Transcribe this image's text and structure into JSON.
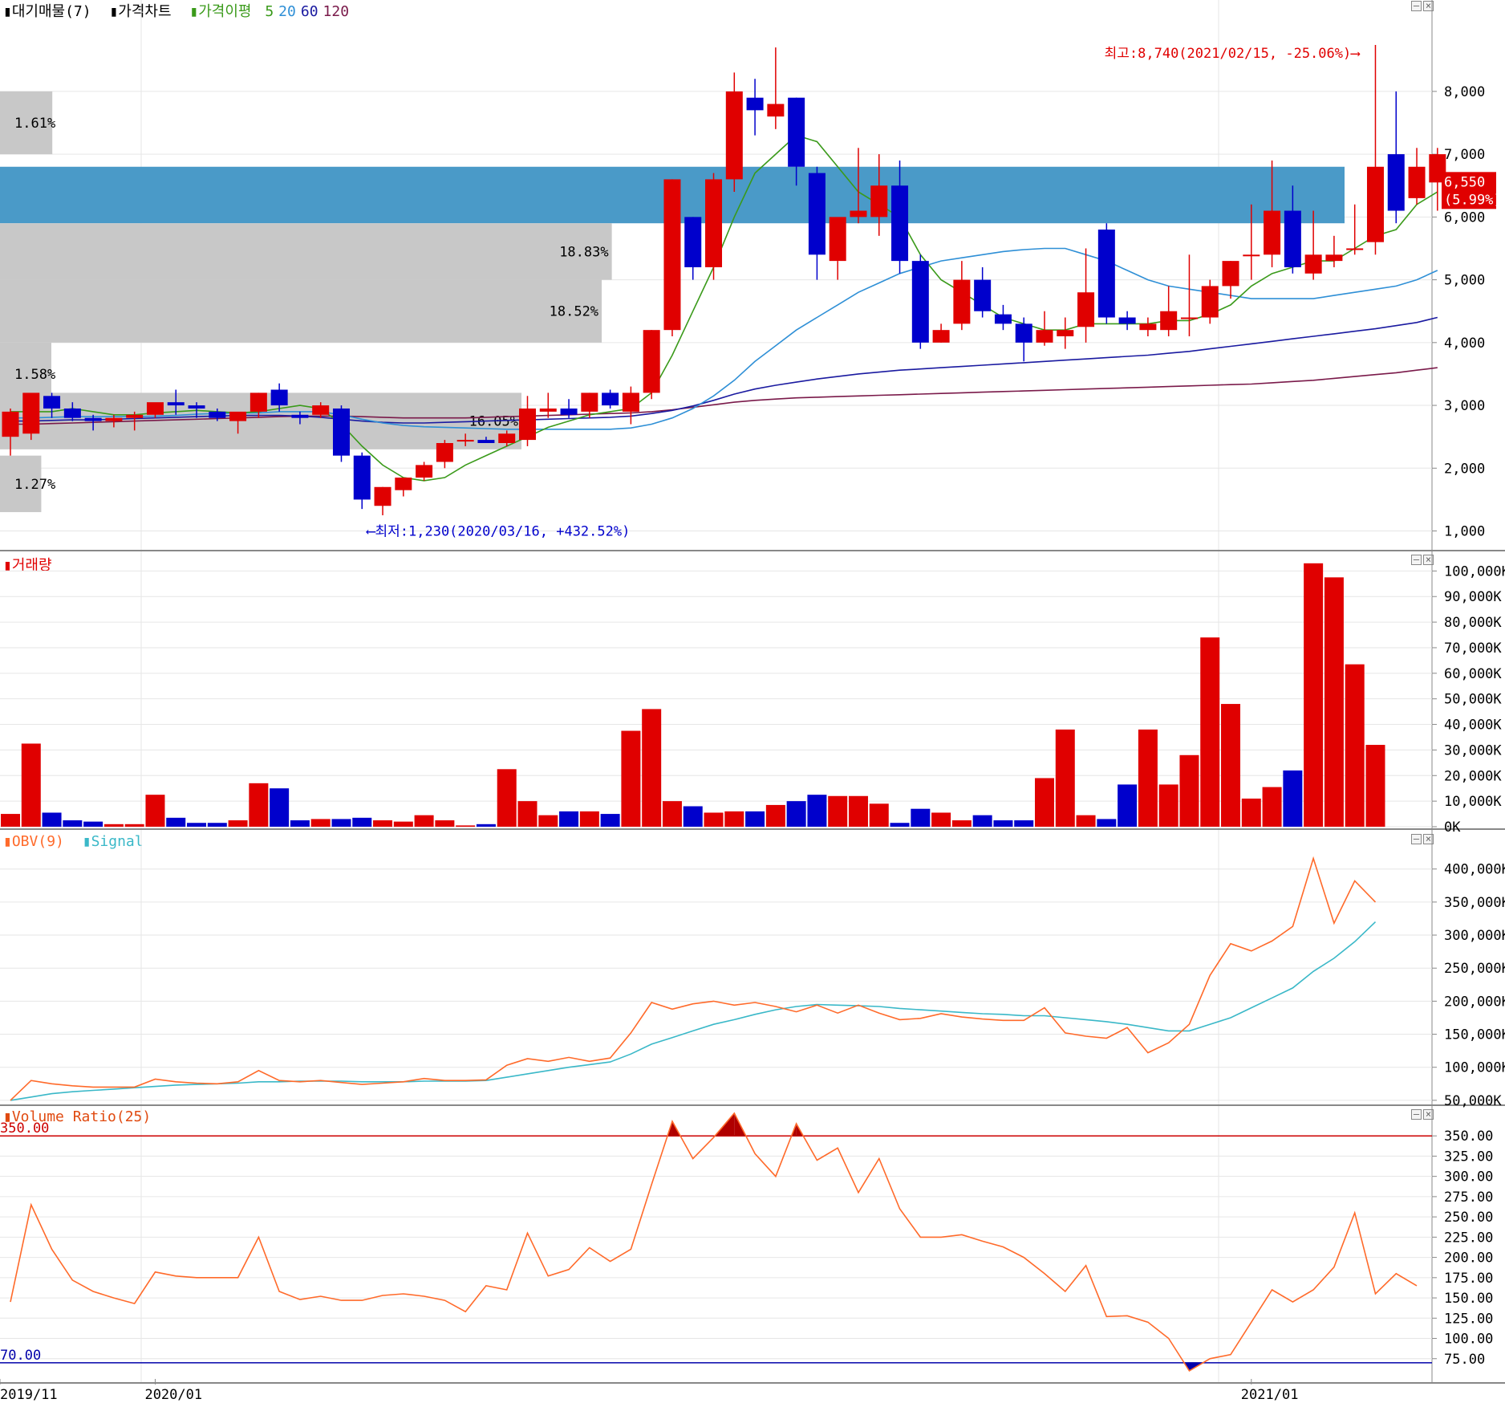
{
  "legend": {
    "price": {
      "volume_profile": "대기매물(7)",
      "price_chart": "가격차트",
      "ma_label": "가격이평",
      "ma5": "5",
      "ma20": "20",
      "ma60": "60",
      "ma120": "120"
    },
    "volume": "거래량",
    "obv": "OBV(9)",
    "signal": "Signal",
    "volume_ratio": "Volume Ratio(25)"
  },
  "colors": {
    "up": "#e00000",
    "down": "#0000cc",
    "ma5": "#3a9a1a",
    "ma20": "#2e8fd6",
    "ma60": "#1a1aa0",
    "ma120": "#7a1a4a",
    "obv": "#ff6a2a",
    "signal": "#3ab8c8",
    "vr": "#ff6a2a",
    "profile": "#c8c8c8",
    "profile_highlight": "#4a9ac8"
  },
  "chart_data": [
    {
      "type": "candlestick",
      "ylim": [
        700,
        9200
      ],
      "yticks": [
        "1,000",
        "2,000",
        "3,000",
        "4,000",
        "5,000",
        "6,000",
        "7,000",
        "8,000"
      ],
      "ytick_values": [
        1000,
        2000,
        3000,
        4000,
        5000,
        6000,
        7000,
        8000
      ],
      "x_labels": [
        {
          "index": 0,
          "label": "2019/11"
        },
        {
          "index": 7,
          "label": "2020/01"
        },
        {
          "index": 60,
          "label": "2021/01"
        }
      ],
      "candles": [
        [
          2500,
          2950,
          2200,
          2900
        ],
        [
          2550,
          3100,
          2450,
          3200
        ],
        [
          3150,
          3200,
          2800,
          2950
        ],
        [
          2950,
          3050,
          2750,
          2800
        ],
        [
          2800,
          2850,
          2600,
          2750
        ],
        [
          2750,
          2850,
          2650,
          2800
        ],
        [
          2800,
          2900,
          2600,
          2850
        ],
        [
          2850,
          2950,
          2800,
          3050
        ],
        [
          3050,
          3250,
          2850,
          3000
        ],
        [
          3000,
          3050,
          2800,
          2950
        ],
        [
          2900,
          2950,
          2750,
          2800
        ],
        [
          2750,
          2850,
          2550,
          2900
        ],
        [
          2900,
          3200,
          2800,
          3200
        ],
        [
          3250,
          3350,
          2900,
          3000
        ],
        [
          2850,
          2900,
          2700,
          2800
        ],
        [
          2850,
          3050,
          2800,
          3000
        ],
        [
          2950,
          3000,
          2100,
          2200
        ],
        [
          2200,
          2250,
          1350,
          1500
        ],
        [
          1400,
          1700,
          1250,
          1700
        ],
        [
          1650,
          1850,
          1550,
          1850
        ],
        [
          1850,
          2100,
          1800,
          2050
        ],
        [
          2100,
          2450,
          2000,
          2400
        ],
        [
          2450,
          2550,
          2350,
          2450
        ],
        [
          2450,
          2500,
          2400,
          2400
        ],
        [
          2400,
          2600,
          2350,
          2550
        ],
        [
          2450,
          3150,
          2350,
          2950
        ],
        [
          2900,
          3200,
          2800,
          2950
        ],
        [
          2950,
          3100,
          2800,
          2850
        ],
        [
          2900,
          3200,
          2800,
          3200
        ],
        [
          3200,
          3250,
          2950,
          3000
        ],
        [
          2900,
          3300,
          2700,
          3200
        ],
        [
          3200,
          4200,
          3100,
          4200
        ],
        [
          4200,
          6600,
          4100,
          6600
        ],
        [
          6000,
          6000,
          5000,
          5200
        ],
        [
          5200,
          6700,
          5000,
          6600
        ],
        [
          6600,
          8300,
          6400,
          8000
        ],
        [
          7900,
          8200,
          7300,
          7700
        ],
        [
          7600,
          8700,
          7400,
          7800
        ],
        [
          7900,
          7900,
          6500,
          6800
        ],
        [
          6700,
          6800,
          5000,
          5400
        ],
        [
          5300,
          5300,
          5000,
          6000
        ],
        [
          6000,
          7100,
          5900,
          6100
        ],
        [
          6000,
          7000,
          5700,
          6500
        ],
        [
          6500,
          6900,
          5100,
          5300
        ],
        [
          5300,
          5400,
          3900,
          4000
        ],
        [
          4000,
          4300,
          4000,
          4200
        ],
        [
          4300,
          5300,
          4200,
          5000
        ],
        [
          5000,
          5200,
          4400,
          4500
        ],
        [
          4450,
          4600,
          4200,
          4300
        ],
        [
          4300,
          4400,
          3700,
          4000
        ],
        [
          4000,
          4500,
          3950,
          4200
        ],
        [
          4100,
          4400,
          3900,
          4200
        ],
        [
          4250,
          5500,
          4000,
          4800
        ],
        [
          5800,
          5900,
          4300,
          4400
        ],
        [
          4400,
          4500,
          4200,
          4300
        ],
        [
          4200,
          4400,
          4100,
          4300
        ],
        [
          4200,
          4900,
          4100,
          4500
        ],
        [
          4400,
          5400,
          4100,
          4400
        ],
        [
          4400,
          5000,
          4300,
          4900
        ],
        [
          4900,
          5300,
          4700,
          5300
        ],
        [
          5400,
          6200,
          5000,
          5400
        ],
        [
          5400,
          6900,
          5200,
          6100
        ],
        [
          6100,
          6500,
          5100,
          5200
        ],
        [
          5100,
          6100,
          5000,
          5400
        ],
        [
          5300,
          5700,
          5200,
          5400
        ],
        [
          5500,
          6200,
          5400,
          5500
        ],
        [
          5600,
          8740,
          5400,
          6800
        ],
        [
          7000,
          8000,
          5900,
          6100
        ],
        [
          6300,
          7100,
          6200,
          6800
        ],
        [
          6550,
          7100,
          6100,
          7000
        ]
      ],
      "ma5": [
        2900,
        2900,
        2900,
        2950,
        2900,
        2850,
        2850,
        2880,
        2900,
        2920,
        2900,
        2880,
        2900,
        2950,
        3000,
        2950,
        2700,
        2350,
        2050,
        1850,
        1800,
        1850,
        2050,
        2200,
        2350,
        2500,
        2650,
        2750,
        2850,
        2900,
        2950,
        3200,
        3800,
        4500,
        5200,
        6000,
        6700,
        7000,
        7300,
        7200,
        6800,
        6400,
        6200,
        6000,
        5400,
        5000,
        4800,
        4600,
        4400,
        4300,
        4200,
        4200,
        4300,
        4300,
        4300,
        4300,
        4350,
        4350,
        4450,
        4600,
        4900,
        5100,
        5200,
        5300,
        5300,
        5500,
        5700,
        5800,
        6200,
        6400
      ],
      "ma20": [
        2800,
        2800,
        2810,
        2820,
        2820,
        2820,
        2820,
        2830,
        2840,
        2860,
        2870,
        2880,
        2880,
        2900,
        2900,
        2900,
        2850,
        2780,
        2720,
        2680,
        2660,
        2650,
        2640,
        2630,
        2620,
        2620,
        2620,
        2620,
        2620,
        2620,
        2640,
        2700,
        2800,
        2950,
        3150,
        3400,
        3700,
        3950,
        4200,
        4400,
        4600,
        4800,
        4950,
        5100,
        5200,
        5300,
        5350,
        5400,
        5450,
        5480,
        5500,
        5500,
        5400,
        5300,
        5150,
        5000,
        4900,
        4850,
        4800,
        4750,
        4700,
        4700,
        4700,
        4700,
        4750,
        4800,
        4850,
        4900,
        5000,
        5150
      ],
      "ma60": [
        2750,
        2750,
        2760,
        2770,
        2770,
        2780,
        2790,
        2800,
        2810,
        2820,
        2830,
        2840,
        2840,
        2840,
        2830,
        2810,
        2780,
        2750,
        2730,
        2720,
        2720,
        2730,
        2740,
        2750,
        2760,
        2770,
        2780,
        2790,
        2800,
        2810,
        2830,
        2870,
        2920,
        2990,
        3080,
        3180,
        3260,
        3320,
        3370,
        3420,
        3460,
        3500,
        3530,
        3560,
        3580,
        3600,
        3620,
        3640,
        3660,
        3680,
        3700,
        3720,
        3740,
        3760,
        3780,
        3800,
        3830,
        3860,
        3900,
        3940,
        3980,
        4020,
        4060,
        4100,
        4140,
        4180,
        4220,
        4270,
        4320,
        4400
      ],
      "ma120": [
        2700,
        2700,
        2710,
        2720,
        2730,
        2740,
        2750,
        2760,
        2770,
        2780,
        2790,
        2800,
        2810,
        2820,
        2830,
        2830,
        2830,
        2820,
        2810,
        2800,
        2800,
        2800,
        2800,
        2810,
        2820,
        2830,
        2840,
        2850,
        2860,
        2870,
        2880,
        2900,
        2930,
        2970,
        3010,
        3050,
        3080,
        3100,
        3120,
        3130,
        3140,
        3150,
        3160,
        3170,
        3180,
        3190,
        3200,
        3210,
        3220,
        3230,
        3240,
        3250,
        3260,
        3270,
        3280,
        3290,
        3300,
        3310,
        3320,
        3330,
        3340,
        3360,
        3380,
        3400,
        3430,
        3460,
        3490,
        3520,
        3560,
        3600
      ],
      "volume_profile": [
        {
          "low": 7000,
          "high": 8000,
          "pct": 1.61,
          "label": "1.61%"
        },
        {
          "low": 5900,
          "high": 6800,
          "pct": 100,
          "label": "",
          "highlight": true
        },
        {
          "low": 5000,
          "high": 5900,
          "pct": 18.83,
          "label": "18.83%"
        },
        {
          "low": 4000,
          "high": 5000,
          "pct": 18.52,
          "label": "18.52%"
        },
        {
          "low": 3000,
          "high": 4000,
          "pct": 1.58,
          "label": "1.58%"
        },
        {
          "low": 2300,
          "high": 3200,
          "pct": 16.05,
          "label": "16.05%"
        },
        {
          "low": 1300,
          "high": 2200,
          "pct": 1.27,
          "label": "1.27%"
        }
      ],
      "annotations": {
        "high": "최고:8,740(2021/02/15, -25.06%)",
        "low": "최저:1,230(2020/03/16, +432.52%)"
      },
      "current_price": {
        "value": 6550,
        "label": "6,550",
        "change": "(5.99%)"
      }
    },
    {
      "type": "bar",
      "title": "거래량",
      "ylim": [
        0,
        102000
      ],
      "yticks": [
        "0K",
        "10,000K",
        "20,000K",
        "30,000K",
        "40,000K",
        "50,000K",
        "60,000K",
        "70,000K",
        "80,000K",
        "90,000K",
        "100,000K"
      ],
      "ytick_values": [
        0,
        10000,
        20000,
        30000,
        40000,
        50000,
        60000,
        70000,
        80000,
        90000,
        100000
      ],
      "units": "K",
      "values": [
        5000,
        32500,
        5500,
        2500,
        2000,
        1000,
        1000,
        12500,
        3500,
        1500,
        1500,
        2500,
        17000,
        15000,
        2500,
        3000,
        3000,
        3500,
        2500,
        2000,
        4500,
        2500,
        500,
        1000,
        22500,
        10000,
        4500,
        6000,
        6000,
        5000,
        37500,
        46000,
        10000,
        8000,
        5500,
        6000,
        6000,
        8500,
        10000,
        12500,
        12000,
        12000,
        9000,
        1500,
        7000,
        5500,
        2500,
        4500,
        2500,
        2500,
        19000,
        38000,
        4500,
        3000,
        16500,
        38000,
        16500,
        28000,
        74000,
        48000,
        11000,
        15500,
        22000,
        103000,
        97500,
        63500,
        32000
      ]
    },
    {
      "type": "line",
      "title": "OBV(9)",
      "ylim": [
        45000,
        430000
      ],
      "yticks": [
        "50,000K",
        "100,000K",
        "150,000K",
        "200,000K",
        "250,000K",
        "300,000K",
        "350,000K",
        "400,000K"
      ],
      "ytick_values": [
        50000,
        100000,
        150000,
        200000,
        250000,
        300000,
        350000,
        400000
      ],
      "units": "K",
      "series": [
        {
          "name": "OBV(9)",
          "values": [
            50000,
            80000,
            75000,
            72000,
            70000,
            70000,
            70000,
            82000,
            78000,
            76000,
            75000,
            78000,
            95000,
            80000,
            78000,
            80000,
            77000,
            74000,
            76000,
            78000,
            83000,
            80000,
            80000,
            81000,
            103000,
            113000,
            109000,
            115000,
            109000,
            114000,
            152000,
            198000,
            188000,
            196000,
            200000,
            194000,
            198000,
            192000,
            184000,
            194000,
            182000,
            194000,
            182000,
            172000,
            174000,
            181000,
            176000,
            173000,
            171000,
            171000,
            190000,
            152000,
            147000,
            144000,
            160000,
            122000,
            137000,
            165000,
            239000,
            287000,
            276000,
            291000,
            313000,
            416000,
            318000,
            382000,
            350000
          ]
        },
        {
          "name": "Signal",
          "values": [
            50000,
            55000,
            60000,
            63000,
            65000,
            67000,
            69000,
            71000,
            73000,
            74000,
            75000,
            76000,
            78000,
            78000,
            79000,
            79000,
            79000,
            78000,
            78000,
            78000,
            79000,
            79000,
            79000,
            80000,
            85000,
            90000,
            95000,
            100000,
            104000,
            108000,
            120000,
            135000,
            145000,
            155000,
            165000,
            172000,
            180000,
            187000,
            192000,
            195000,
            194000,
            193000,
            192000,
            189000,
            187000,
            185000,
            183000,
            181000,
            180000,
            178000,
            178000,
            175000,
            172000,
            169000,
            165000,
            160000,
            155000,
            155000,
            165000,
            175000,
            190000,
            205000,
            220000,
            245000,
            265000,
            290000,
            320000
          ]
        }
      ]
    },
    {
      "type": "line",
      "title": "Volume Ratio(25)",
      "ylim": [
        50,
        370
      ],
      "yticks": [
        "75.00",
        "100.00",
        "125.00",
        "150.00",
        "175.00",
        "200.00",
        "225.00",
        "250.00",
        "275.00",
        "300.00",
        "325.00",
        "350.00"
      ],
      "ytick_values": [
        75,
        100,
        125,
        150,
        175,
        200,
        225,
        250,
        275,
        300,
        325,
        350
      ],
      "reference_lines": [
        {
          "value": 350,
          "label": "350.00",
          "color": "#cc0000"
        },
        {
          "value": 70,
          "label": "70.00",
          "color": "#0000aa"
        }
      ],
      "series": [
        {
          "name": "Volume Ratio(25)",
          "values": [
            145,
            265,
            210,
            172,
            158,
            150,
            143,
            182,
            177,
            175,
            175,
            175,
            225,
            158,
            148,
            152,
            147,
            147,
            153,
            155,
            152,
            147,
            133,
            165,
            160,
            230,
            177,
            185,
            212,
            195,
            210,
            290,
            368,
            322,
            348,
            378,
            328,
            300,
            365,
            320,
            335,
            280,
            322,
            260,
            225,
            225,
            228,
            220,
            213,
            200,
            180,
            158,
            190,
            127,
            128,
            120,
            100,
            60,
            75,
            80,
            120,
            160,
            145,
            160,
            188,
            255,
            155,
            180,
            165
          ]
        }
      ]
    }
  ]
}
